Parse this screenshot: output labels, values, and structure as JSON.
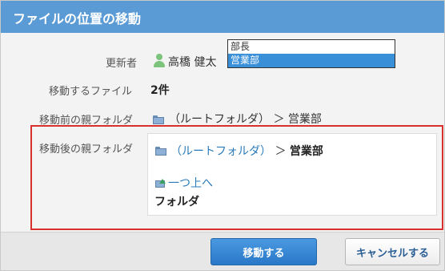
{
  "dialog": {
    "title": "ファイルの位置の移動"
  },
  "form": {
    "updater": {
      "label": "更新者",
      "value": "高橋 健太"
    },
    "dropdown": {
      "options": [
        "部長",
        "営業部"
      ],
      "selected": "営業部"
    },
    "files": {
      "label": "移動するファイル",
      "value": "2件"
    },
    "before": {
      "label": "移動前の親フォルダ",
      "path": "（ルートフォルダ）",
      "separator": "＞",
      "current": "営業部"
    },
    "after": {
      "label": "移動後の親フォルダ",
      "path_link": "（ルートフォルダ）",
      "separator": "＞",
      "current": "営業部",
      "up_link": "一つ上へ",
      "folder_heading": "フォルダ"
    }
  },
  "buttons": {
    "move": "移動する",
    "cancel": "キャンセルする"
  },
  "colors": {
    "titlebar": "#5b9bd5",
    "highlight_border": "#d9302e",
    "link": "#2a7ab8",
    "primary_button": "#2a78c8"
  },
  "icons": {
    "user": "user-icon",
    "folder": "folder-icon",
    "up": "folder-up-icon"
  }
}
